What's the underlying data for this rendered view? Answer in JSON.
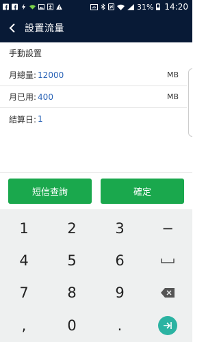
{
  "status_bar": {
    "battery": "31%",
    "time": "14:20"
  },
  "app_bar": {
    "title": "設置流量"
  },
  "form": {
    "section_title": "手動設置",
    "monthly_total": {
      "label": "月總量:",
      "value": "12000",
      "unit": "MB"
    },
    "monthly_used": {
      "label": "月已用:",
      "value": "400",
      "unit": "MB"
    },
    "settlement_day": {
      "label": "結算日:",
      "value": "1"
    }
  },
  "buttons": {
    "sms_query": "短信查詢",
    "confirm": "確定"
  },
  "keypad": {
    "k1": "1",
    "k2": "2",
    "k3": "3",
    "minus": "−",
    "k4": "4",
    "k5": "5",
    "k6": "6",
    "k7": "7",
    "k8": "8",
    "k9": "9",
    "comma": ",",
    "k0": "0",
    "dot": "."
  },
  "colors": {
    "header_bg": "#081a36",
    "value_text": "#2a63b6",
    "button_green": "#1aa84d",
    "enter_teal": "#2bb3a2",
    "keypad_bg": "#eef0f0"
  }
}
